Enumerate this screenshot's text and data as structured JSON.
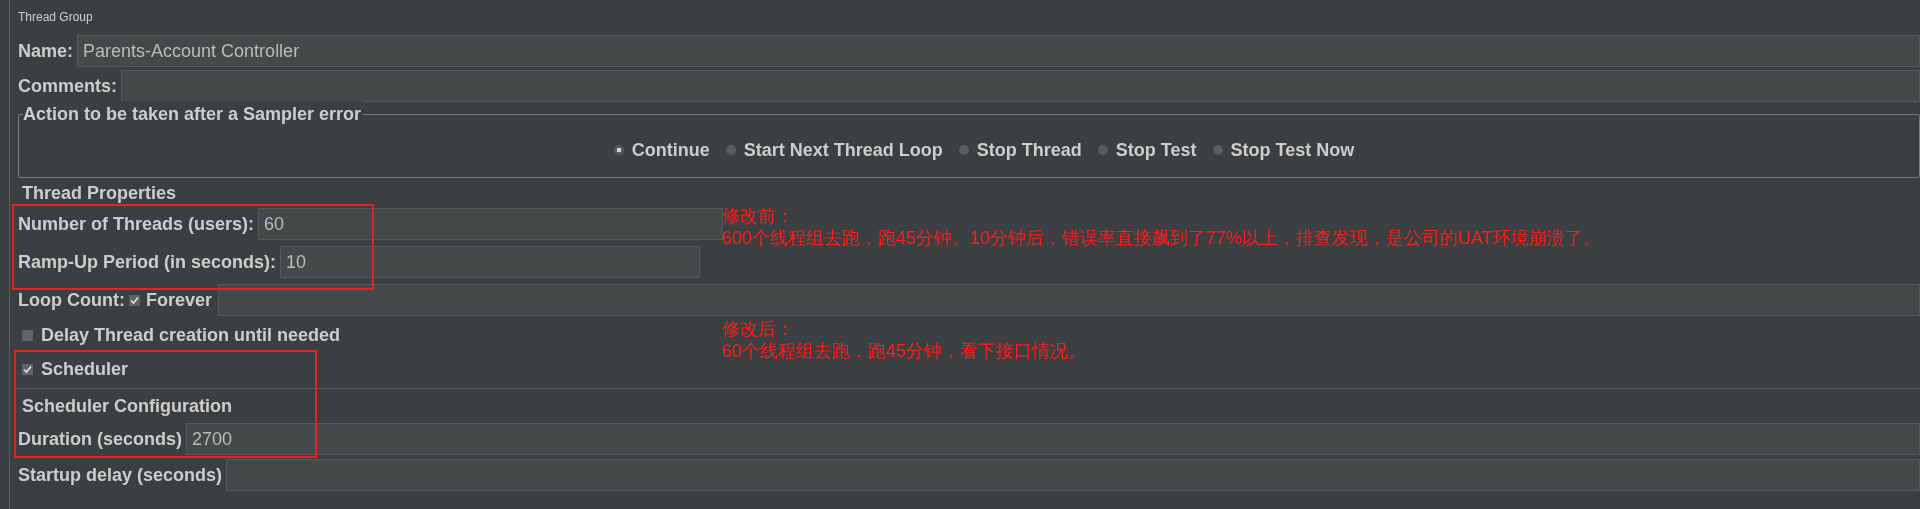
{
  "panel_title": "Thread Group",
  "name": {
    "label": "Name:",
    "value": "Parents-Account Controller"
  },
  "comments": {
    "label": "Comments:"
  },
  "sampler_error": {
    "legend": "Action to be taken after a Sampler error",
    "options": [
      {
        "label": "Continue",
        "selected": true
      },
      {
        "label": "Start Next Thread Loop",
        "selected": false
      },
      {
        "label": "Stop Thread",
        "selected": false
      },
      {
        "label": "Stop Test",
        "selected": false
      },
      {
        "label": "Stop Test Now",
        "selected": false
      }
    ]
  },
  "thread_properties": {
    "heading": "Thread Properties",
    "threads": {
      "label": "Number of Threads (users):",
      "value": "60"
    },
    "ramp_up": {
      "label": "Ramp-Up Period (in seconds):",
      "value": "10"
    },
    "loop_count": {
      "label": "Loop Count:",
      "forever_label": "Forever",
      "forever_checked": true
    },
    "delay_creation": {
      "label": "Delay Thread creation until needed",
      "checked": false
    },
    "scheduler": {
      "label": "Scheduler",
      "checked": true
    }
  },
  "scheduler_configuration": {
    "heading": "Scheduler Configuration",
    "duration": {
      "label": "Duration (seconds)",
      "value": "2700"
    },
    "startup_delay": {
      "label": "Startup delay (seconds)"
    }
  },
  "annotations": [
    {
      "title": "修改前：",
      "text": "600个线程组去跑，跑45分钟。10分钟后，错误率直接飙到了77%以上，排查发现，是公司的UAT环境崩溃了。"
    },
    {
      "title": "修改后：",
      "text": "60个线程组去跑，跑45分钟，看下接口情况。"
    }
  ]
}
